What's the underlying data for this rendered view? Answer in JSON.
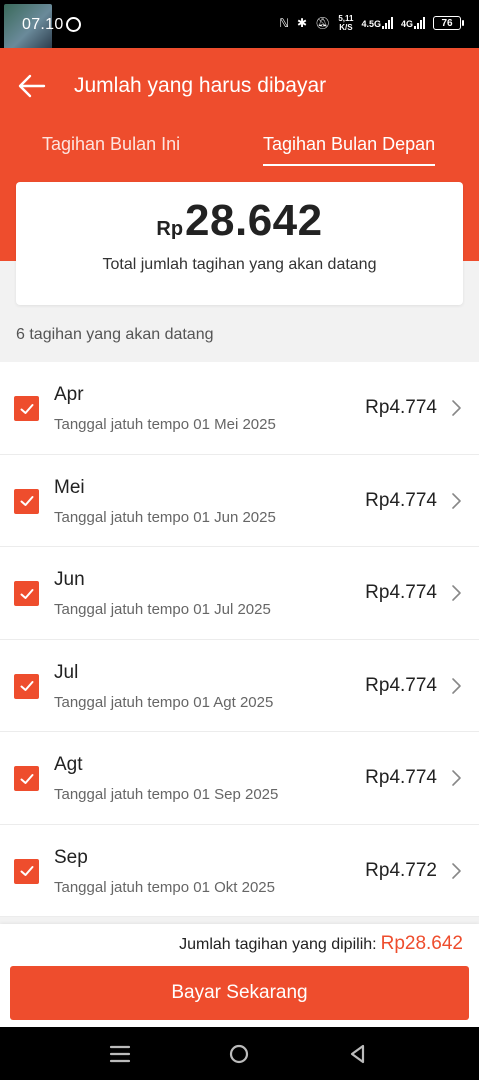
{
  "status_bar": {
    "time": "07.10",
    "speed_value": "5,11",
    "speed_unit": "K/S",
    "network_1": "4.5G",
    "network_2": "4G",
    "battery": "76"
  },
  "header": {
    "title": "Jumlah yang harus dibayar",
    "tabs": [
      {
        "label": "Tagihan Bulan Ini",
        "active": false
      },
      {
        "label": "Tagihan Bulan Depan",
        "active": true
      }
    ]
  },
  "summary": {
    "currency": "Rp",
    "amount": "28.642",
    "caption": "Total jumlah tagihan yang akan datang"
  },
  "upcoming_count": "6 tagihan yang akan datang",
  "bills": [
    {
      "month": "Apr",
      "due": "Tanggal jatuh tempo 01 Mei 2025",
      "amount": "Rp4.774",
      "checked": true
    },
    {
      "month": "Mei",
      "due": "Tanggal jatuh tempo 01 Jun 2025",
      "amount": "Rp4.774",
      "checked": true
    },
    {
      "month": "Jun",
      "due": "Tanggal jatuh tempo 01 Jul 2025",
      "amount": "Rp4.774",
      "checked": true
    },
    {
      "month": "Jul",
      "due": "Tanggal jatuh tempo 01 Agt 2025",
      "amount": "Rp4.774",
      "checked": true
    },
    {
      "month": "Agt",
      "due": "Tanggal jatuh tempo 01 Sep 2025",
      "amount": "Rp4.774",
      "checked": true
    },
    {
      "month": "Sep",
      "due": "Tanggal jatuh tempo 01 Okt 2025",
      "amount": "Rp4.772",
      "checked": true
    }
  ],
  "footer": {
    "selected_label": "Jumlah tagihan yang dipilih:",
    "selected_amount": "Rp28.642",
    "pay_label": "Bayar Sekarang"
  },
  "colors": {
    "brand": "#ee4d2d",
    "background": "#f2f2f2"
  },
  "icons": {
    "back": "arrow-left-icon",
    "checkbox": "check-icon",
    "chevron": "chevron-right-icon",
    "nav": [
      "menu-icon",
      "home-circle-icon",
      "back-triangle-icon"
    ]
  }
}
